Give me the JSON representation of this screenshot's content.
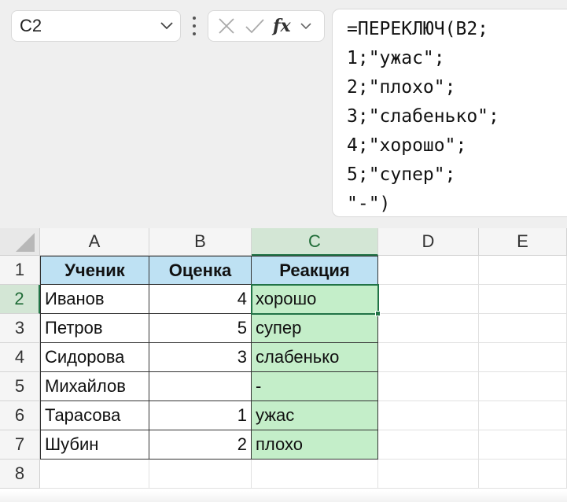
{
  "name_box": {
    "ref": "C2"
  },
  "formula_bar": {
    "lines": [
      "=ПЕРЕКЛЮЧ(B2;",
      "1;\"ужас\";",
      "2;\"плохо\";",
      "3;\"слабенько\";",
      "4;\"хорошо\";",
      "5;\"супер\";",
      "\"-\")"
    ],
    "fx_label": "fx"
  },
  "columns": [
    "A",
    "B",
    "C",
    "D",
    "E"
  ],
  "active_column": "C",
  "rows": [
    "1",
    "2",
    "3",
    "4",
    "5",
    "6",
    "7",
    "8"
  ],
  "active_row": "2",
  "table": {
    "headers": [
      "Ученик",
      "Оценка",
      "Реакция"
    ],
    "data": [
      [
        "Иванов",
        "4",
        "хорошо"
      ],
      [
        "Петров",
        "5",
        "супер"
      ],
      [
        "Сидорова",
        "3",
        "слабенько"
      ],
      [
        "Михайлов",
        "",
        "-"
      ],
      [
        "Тарасова",
        "1",
        "ужас"
      ],
      [
        "Шубин",
        "2",
        "плохо"
      ]
    ]
  },
  "colors": {
    "header_fill": "#bee1f3",
    "result_fill": "#c4eec9",
    "selection": "#217346"
  }
}
